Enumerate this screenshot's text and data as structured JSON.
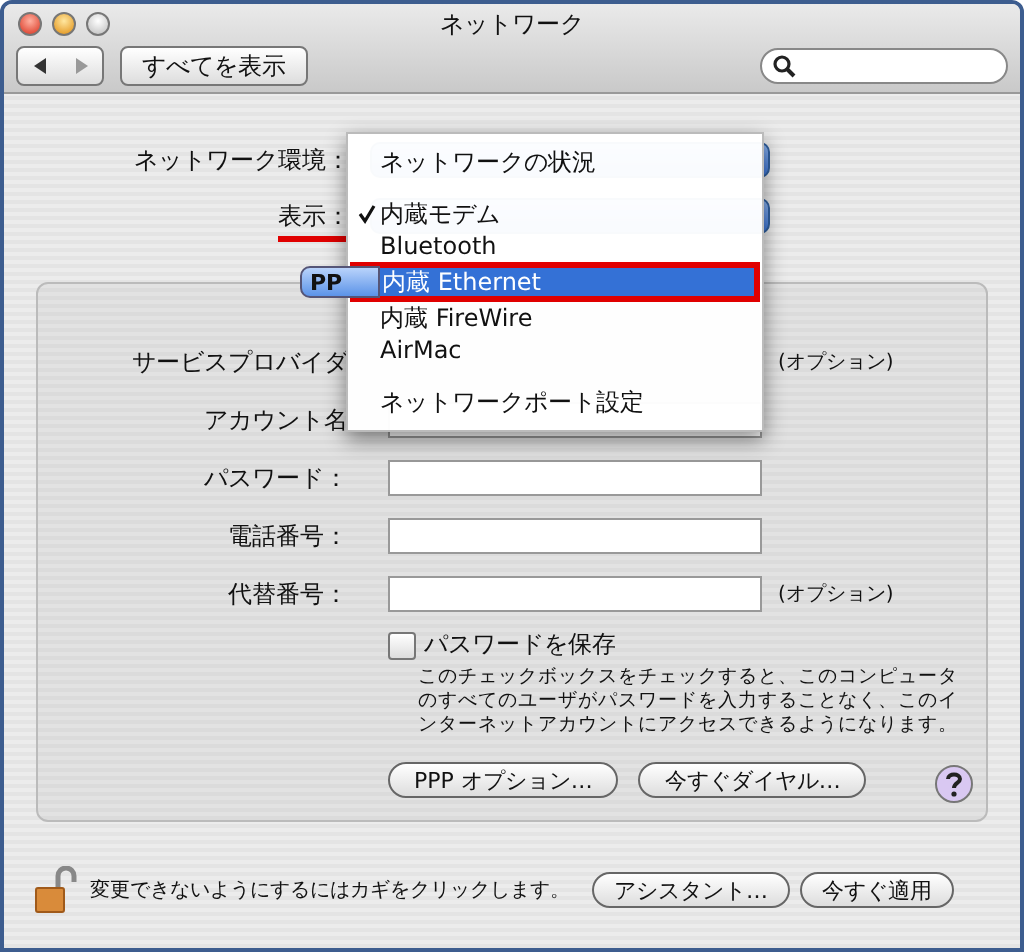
{
  "window": {
    "title": "ネットワーク"
  },
  "toolbar": {
    "show_all": "すべてを表示"
  },
  "location": {
    "label": "ネットワーク環境："
  },
  "show": {
    "label": "表示：",
    "underlined": true
  },
  "menu": {
    "items": [
      {
        "kind": "item",
        "label": "ネットワークの状況",
        "checked": false,
        "selected": false,
        "annotated": false
      },
      {
        "kind": "separator"
      },
      {
        "kind": "item",
        "label": "内蔵モデム",
        "checked": true,
        "selected": false,
        "annotated": false
      },
      {
        "kind": "item",
        "label": "Bluetooth",
        "checked": false,
        "selected": false,
        "annotated": false
      },
      {
        "kind": "item",
        "label": "内蔵 Ethernet",
        "checked": false,
        "selected": true,
        "annotated": true
      },
      {
        "kind": "item",
        "label": "内蔵 FireWire",
        "checked": false,
        "selected": false,
        "annotated": false
      },
      {
        "kind": "item",
        "label": "AirMac",
        "checked": false,
        "selected": false,
        "annotated": false
      },
      {
        "kind": "separator"
      },
      {
        "kind": "item",
        "label": "ネットワークポート設定",
        "checked": false,
        "selected": false,
        "annotated": false
      }
    ]
  },
  "tabs": [
    {
      "label": "PP",
      "selected": true
    }
  ],
  "form": {
    "rows": [
      {
        "kind": "label",
        "label": "サービスプロバイダ",
        "note": "(オプション)"
      },
      {
        "kind": "field",
        "label": "アカウント名"
      },
      {
        "kind": "field",
        "label": "パスワード："
      },
      {
        "kind": "field",
        "label": "電話番号："
      },
      {
        "kind": "field",
        "label": "代替番号：",
        "note": "(オプション)"
      }
    ]
  },
  "save_password": {
    "label": "パスワードを保存",
    "checked": false,
    "description": "このチェックボックスをチェックすると、このコンピュータのすべてのユーザがパスワードを入力することなく、このインターネットアカウントにアクセスできるようになります。"
  },
  "buttons": [
    "PPP オプション…",
    "今すぐダイヤル…"
  ],
  "footer": {
    "lock_text": "変更できないようにするにはカギをクリックします。",
    "buttons": [
      "アシスタント…",
      "今すぐ適用"
    ]
  }
}
